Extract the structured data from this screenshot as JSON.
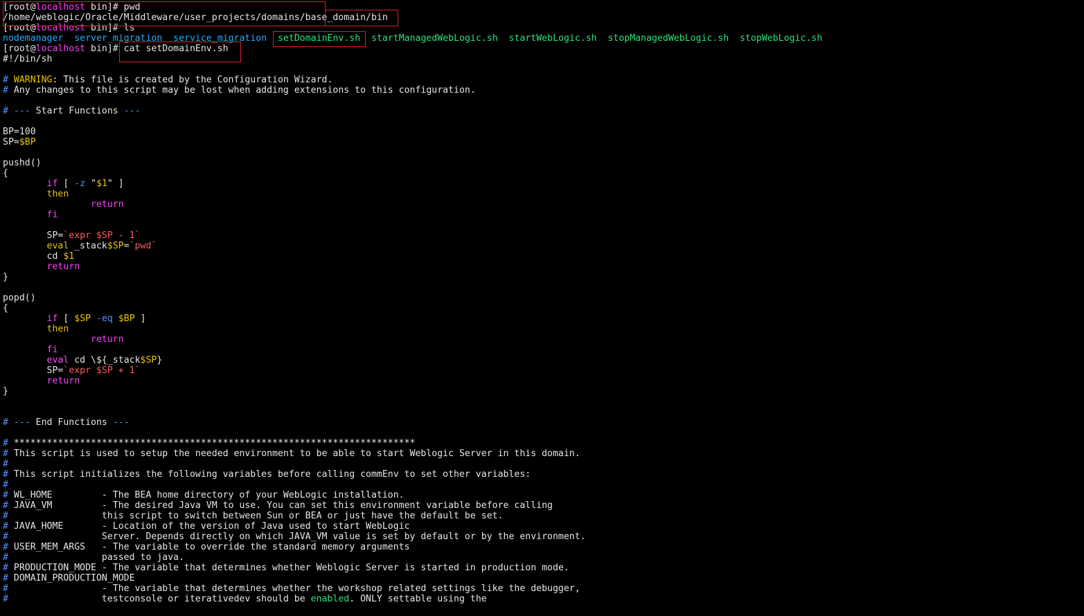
{
  "colors": {
    "background": "#000000",
    "text": "#e6e6e6",
    "host": "#ff40ff",
    "dir": "#29a9ff",
    "exe": "#2ee07a",
    "comment_marker": "#5a8cff",
    "warning": "#e8c400",
    "keyword": "#ff40ff",
    "variable": "#e8c400",
    "expr": "#ff5a5a",
    "option": "#5a8cff",
    "highlight_box": "#e0202a"
  },
  "terminal": {
    "lines": [
      [
        {
          "t": "[root@",
          "c": "text"
        },
        {
          "t": "localhost",
          "c": "host"
        },
        {
          "t": " bin]# pwd",
          "c": "text"
        }
      ],
      [
        {
          "t": "/home/weblogic/Oracle/Middleware/user_projects/domains/base_domain/bin",
          "c": "text"
        }
      ],
      [
        {
          "t": "[root@",
          "c": "text"
        },
        {
          "t": "localhost",
          "c": "host"
        },
        {
          "t": " bin]# ls",
          "c": "text"
        }
      ],
      [
        {
          "t": "nodemanager",
          "c": "dir"
        },
        {
          "t": "  ",
          "c": "text"
        },
        {
          "t": "server_migration",
          "c": "dir"
        },
        {
          "t": "  ",
          "c": "text"
        },
        {
          "t": "service_migration",
          "c": "dir"
        },
        {
          "t": "  ",
          "c": "text"
        },
        {
          "t": "setDomainEnv.sh",
          "c": "exe"
        },
        {
          "t": "  ",
          "c": "text"
        },
        {
          "t": "startManagedWebLogic.sh",
          "c": "exe"
        },
        {
          "t": "  ",
          "c": "text"
        },
        {
          "t": "startWebLogic.sh",
          "c": "exe"
        },
        {
          "t": "  ",
          "c": "text"
        },
        {
          "t": "stopManagedWebLogic.sh",
          "c": "exe"
        },
        {
          "t": "  ",
          "c": "text"
        },
        {
          "t": "stopWebLogic.sh",
          "c": "exe"
        }
      ],
      [
        {
          "t": "[root@",
          "c": "text"
        },
        {
          "t": "localhost",
          "c": "host"
        },
        {
          "t": " bin]# cat setDomainEnv.sh",
          "c": "text"
        }
      ],
      [
        {
          "t": "#!/bin/sh",
          "c": "text"
        }
      ],
      [],
      [
        {
          "t": "# ",
          "c": "comment_marker"
        },
        {
          "t": "WARNING",
          "c": "warning"
        },
        {
          "t": ": This file is created by the Configuration Wizard.",
          "c": "text"
        }
      ],
      [
        {
          "t": "# ",
          "c": "comment_marker"
        },
        {
          "t": "Any changes to this script may be lost when adding extensions to this configuration.",
          "c": "text"
        }
      ],
      [],
      [
        {
          "t": "# ",
          "c": "comment_marker"
        },
        {
          "t": "--- ",
          "c": "comment_marker"
        },
        {
          "t": "Start Functions ",
          "c": "text"
        },
        {
          "t": "---",
          "c": "comment_marker"
        }
      ],
      [],
      [
        {
          "t": "BP=100",
          "c": "text"
        }
      ],
      [
        {
          "t": "SP=",
          "c": "text"
        },
        {
          "t": "$BP",
          "c": "variable"
        }
      ],
      [],
      [
        {
          "t": "pushd()",
          "c": "text"
        }
      ],
      [
        {
          "t": "{",
          "c": "text"
        }
      ],
      [
        {
          "t": "        ",
          "c": "text"
        },
        {
          "t": "if",
          "c": "keyword"
        },
        {
          "t": " [ ",
          "c": "text"
        },
        {
          "t": "-z",
          "c": "option"
        },
        {
          "t": " \"",
          "c": "text"
        },
        {
          "t": "$1",
          "c": "variable"
        },
        {
          "t": "\" ]",
          "c": "text"
        }
      ],
      [
        {
          "t": "        ",
          "c": "text"
        },
        {
          "t": "then",
          "c": "variable"
        }
      ],
      [
        {
          "t": "                ",
          "c": "text"
        },
        {
          "t": "return",
          "c": "keyword"
        }
      ],
      [
        {
          "t": "        ",
          "c": "text"
        },
        {
          "t": "fi",
          "c": "keyword"
        }
      ],
      [],
      [
        {
          "t": "        SP=",
          "c": "text"
        },
        {
          "t": "`expr ",
          "c": "expr"
        },
        {
          "t": "$SP",
          "c": "expr"
        },
        {
          "t": " - 1`",
          "c": "expr"
        }
      ],
      [
        {
          "t": "        ",
          "c": "text"
        },
        {
          "t": "eval",
          "c": "variable"
        },
        {
          "t": " _stack",
          "c": "text"
        },
        {
          "t": "$SP",
          "c": "variable"
        },
        {
          "t": "=",
          "c": "text"
        },
        {
          "t": "`pwd`",
          "c": "expr"
        }
      ],
      [
        {
          "t": "        cd ",
          "c": "text"
        },
        {
          "t": "$1",
          "c": "variable"
        }
      ],
      [
        {
          "t": "        ",
          "c": "text"
        },
        {
          "t": "return",
          "c": "keyword"
        }
      ],
      [
        {
          "t": "}",
          "c": "text"
        }
      ],
      [],
      [
        {
          "t": "popd()",
          "c": "text"
        }
      ],
      [
        {
          "t": "{",
          "c": "text"
        }
      ],
      [
        {
          "t": "        ",
          "c": "text"
        },
        {
          "t": "if",
          "c": "keyword"
        },
        {
          "t": " [ ",
          "c": "text"
        },
        {
          "t": "$SP",
          "c": "variable"
        },
        {
          "t": " ",
          "c": "text"
        },
        {
          "t": "-eq",
          "c": "option"
        },
        {
          "t": " ",
          "c": "text"
        },
        {
          "t": "$BP",
          "c": "variable"
        },
        {
          "t": " ]",
          "c": "text"
        }
      ],
      [
        {
          "t": "        ",
          "c": "text"
        },
        {
          "t": "then",
          "c": "variable"
        }
      ],
      [
        {
          "t": "                ",
          "c": "text"
        },
        {
          "t": "return",
          "c": "keyword"
        }
      ],
      [
        {
          "t": "        ",
          "c": "text"
        },
        {
          "t": "fi",
          "c": "keyword"
        }
      ],
      [
        {
          "t": "        ",
          "c": "text"
        },
        {
          "t": "eval",
          "c": "keyword"
        },
        {
          "t": " cd \\${_stack",
          "c": "text"
        },
        {
          "t": "$SP",
          "c": "variable"
        },
        {
          "t": "}",
          "c": "text"
        }
      ],
      [
        {
          "t": "        SP=",
          "c": "text"
        },
        {
          "t": "`expr ",
          "c": "expr"
        },
        {
          "t": "$SP",
          "c": "expr"
        },
        {
          "t": " + 1`",
          "c": "expr"
        }
      ],
      [
        {
          "t": "        ",
          "c": "text"
        },
        {
          "t": "return",
          "c": "keyword"
        }
      ],
      [
        {
          "t": "}",
          "c": "text"
        }
      ],
      [],
      [],
      [
        {
          "t": "# ",
          "c": "comment_marker"
        },
        {
          "t": "--- ",
          "c": "comment_marker"
        },
        {
          "t": "End Functions ",
          "c": "text"
        },
        {
          "t": "---",
          "c": "comment_marker"
        }
      ],
      [],
      [
        {
          "t": "# ",
          "c": "comment_marker"
        },
        {
          "t": "*************************************************************************",
          "c": "text"
        }
      ],
      [
        {
          "t": "# ",
          "c": "comment_marker"
        },
        {
          "t": "This script is used to setup the needed environment to be able to start Weblogic Server in this domain.",
          "c": "text"
        }
      ],
      [
        {
          "t": "#",
          "c": "comment_marker"
        }
      ],
      [
        {
          "t": "# ",
          "c": "comment_marker"
        },
        {
          "t": "This script initializes the following variables before calling commEnv to set other variables:",
          "c": "text"
        }
      ],
      [
        {
          "t": "#",
          "c": "comment_marker"
        }
      ],
      [
        {
          "t": "# ",
          "c": "comment_marker"
        },
        {
          "t": "WL_HOME         - The BEA home directory of your WebLogic installation.",
          "c": "text"
        }
      ],
      [
        {
          "t": "# ",
          "c": "comment_marker"
        },
        {
          "t": "JAVA_VM         - The desired Java VM to use. You can set this environment variable before calling",
          "c": "text"
        }
      ],
      [
        {
          "t": "#                 ",
          "c": "comment_marker"
        },
        {
          "t": "this script to switch between Sun or BEA or just have the default be set.",
          "c": "text"
        }
      ],
      [
        {
          "t": "# ",
          "c": "comment_marker"
        },
        {
          "t": "JAVA_HOME       - Location of the version of Java used to start WebLogic",
          "c": "text"
        }
      ],
      [
        {
          "t": "#                 ",
          "c": "comment_marker"
        },
        {
          "t": "Server. Depends directly on which JAVA_VM value is set by default or by the environment.",
          "c": "text"
        }
      ],
      [
        {
          "t": "# ",
          "c": "comment_marker"
        },
        {
          "t": "USER_MEM_ARGS   - The variable to override the standard memory arguments",
          "c": "text"
        }
      ],
      [
        {
          "t": "#                 ",
          "c": "comment_marker"
        },
        {
          "t": "passed to java.",
          "c": "text"
        }
      ],
      [
        {
          "t": "# ",
          "c": "comment_marker"
        },
        {
          "t": "PRODUCTION_MODE - The variable that determines whether Weblogic Server is started in production mode.",
          "c": "text"
        }
      ],
      [
        {
          "t": "# ",
          "c": "comment_marker"
        },
        {
          "t": "DOMAIN_PRODUCTION_MODE",
          "c": "text"
        }
      ],
      [
        {
          "t": "#               ",
          "c": "comment_marker"
        },
        {
          "t": "  - The variable that determines whether the workshop related settings like the debugger,",
          "c": "text"
        }
      ],
      [
        {
          "t": "#                 ",
          "c": "comment_marker"
        },
        {
          "t": "testconsole or iterativedev should be ",
          "c": "text"
        },
        {
          "t": "enabled",
          "c": "exe"
        },
        {
          "t": ". ONLY settable using the",
          "c": "text"
        }
      ]
    ]
  }
}
